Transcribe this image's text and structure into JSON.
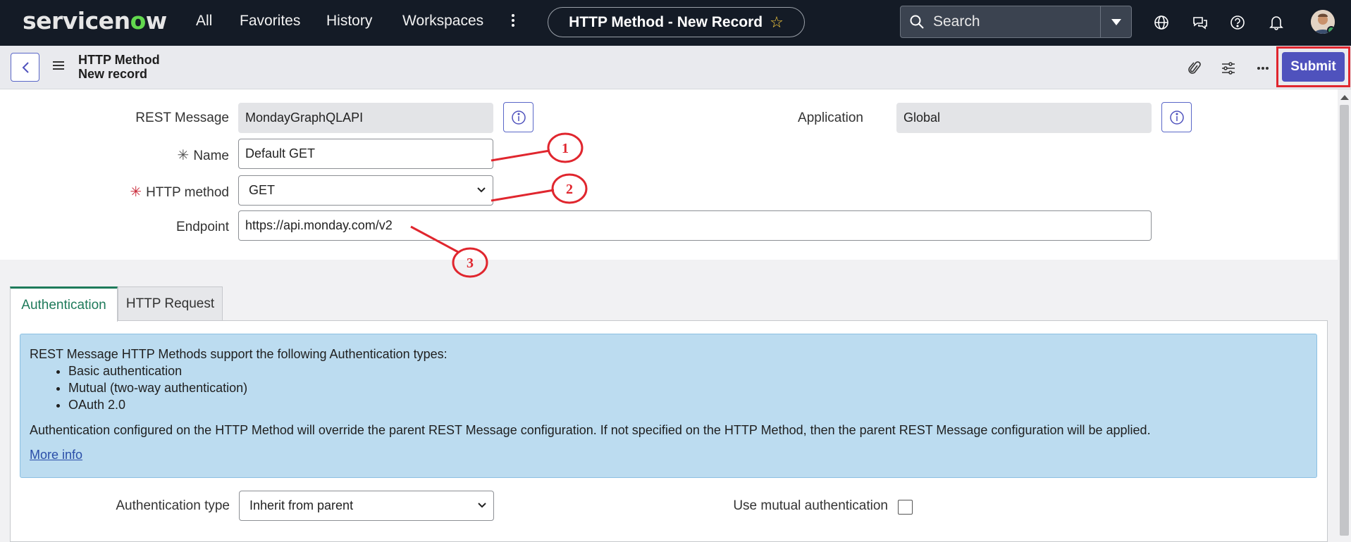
{
  "topbar": {
    "logo_text_a": "servicen",
    "logo_text_o": "o",
    "logo_text_b": "w",
    "nav": [
      "All",
      "Favorites",
      "History",
      "Workspaces"
    ],
    "record_title": "HTTP Method - New Record",
    "search_placeholder": "Search"
  },
  "header": {
    "table_name": "HTTP Method",
    "record_state": "New record",
    "submit_label": "Submit"
  },
  "form": {
    "rest_message": {
      "label": "REST Message",
      "value": "MondayGraphQLAPI"
    },
    "application": {
      "label": "Application",
      "value": "Global"
    },
    "name": {
      "label": "Name",
      "value": "Default GET"
    },
    "http_method": {
      "label": "HTTP method",
      "value": "GET"
    },
    "endpoint": {
      "label": "Endpoint",
      "value": "https://api.monday.com/v2"
    },
    "required_mark": "✳"
  },
  "tabs": [
    "Authentication",
    "HTTP Request"
  ],
  "auth_info": {
    "intro": "REST Message HTTP Methods support the following Authentication types:",
    "types": [
      "Basic authentication",
      "Mutual (two-way authentication)",
      "OAuth 2.0"
    ],
    "note": "Authentication configured on the HTTP Method will override the parent REST Message configuration. If not specified on the HTTP Method, then the parent REST Message configuration will be applied.",
    "link": "More info"
  },
  "auth_fields": {
    "auth_type": {
      "label": "Authentication type",
      "value": "Inherit from parent"
    },
    "mutual": {
      "label": "Use mutual authentication",
      "checked": false
    }
  },
  "annotations": [
    "1",
    "2",
    "3"
  ],
  "colors": {
    "accent": "#4f52bd",
    "annotation": "#e0262e",
    "tab_active": "#1e7a5a",
    "info_bg": "#bcdcf0"
  }
}
